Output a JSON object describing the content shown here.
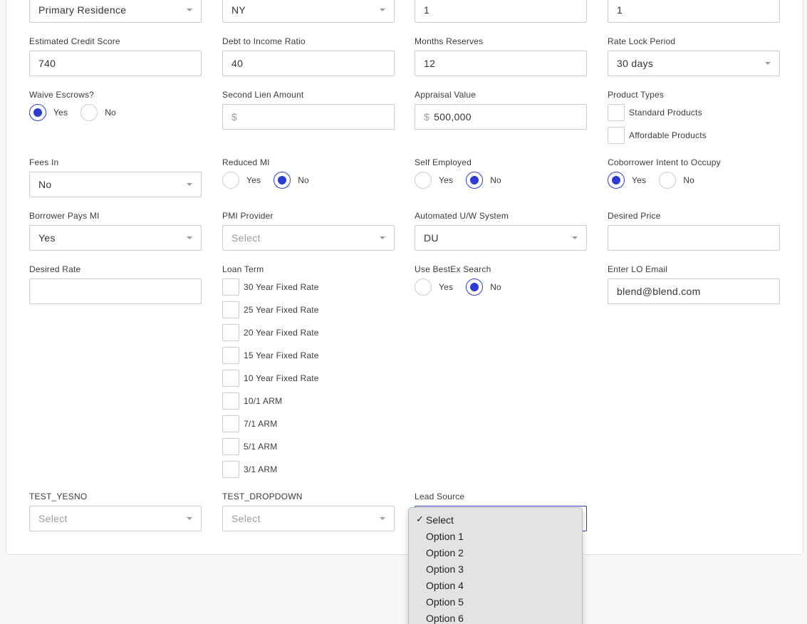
{
  "row0": {
    "occupancy": "Primary Residence",
    "state": "NY",
    "field3": "1",
    "field4": "1"
  },
  "row1": {
    "credit_score": {
      "label": "Estimated Credit Score",
      "value": "740"
    },
    "dti": {
      "label": "Debt to Income Ratio",
      "value": "40"
    },
    "reserves": {
      "label": "Months Reserves",
      "value": "12"
    },
    "rate_lock": {
      "label": "Rate Lock Period",
      "value": "30 days"
    }
  },
  "row2": {
    "waive_escrows": {
      "label": "Waive Escrows?",
      "yes": "Yes",
      "no": "No",
      "selected": "Yes"
    },
    "second_lien": {
      "label": "Second Lien Amount",
      "prefix": "$",
      "value": ""
    },
    "appraisal": {
      "label": "Appraisal Value",
      "prefix": "$",
      "value": "500,000"
    },
    "product_types": {
      "label": "Product Types",
      "options": [
        "Standard Products",
        "Affordable Products"
      ]
    }
  },
  "row3": {
    "fees_in": {
      "label": "Fees In",
      "value": "No"
    },
    "reduced_mi": {
      "label": "Reduced MI",
      "yes": "Yes",
      "no": "No",
      "selected": "No"
    },
    "self_employed": {
      "label": "Self Employed",
      "yes": "Yes",
      "no": "No",
      "selected": "No"
    },
    "coborrower": {
      "label": "Coborrower Intent to Occupy",
      "yes": "Yes",
      "no": "No",
      "selected": "Yes"
    }
  },
  "row4": {
    "borrower_pays_mi": {
      "label": "Borrower Pays MI",
      "value": "Yes"
    },
    "pmi_provider": {
      "label": "PMI Provider",
      "placeholder": "Select"
    },
    "aus": {
      "label": "Automated U/W System",
      "value": "DU"
    },
    "desired_price": {
      "label": "Desired Price",
      "value": ""
    }
  },
  "row5": {
    "desired_rate": {
      "label": "Desired Rate",
      "value": ""
    },
    "loan_term": {
      "label": "Loan Term",
      "options": [
        "30 Year Fixed Rate",
        "25 Year Fixed Rate",
        "20 Year Fixed Rate",
        "15 Year Fixed Rate",
        "10 Year Fixed Rate",
        "10/1 ARM",
        "7/1 ARM",
        "5/1 ARM",
        "3/1 ARM"
      ]
    },
    "bestex": {
      "label": "Use BestEx Search",
      "yes": "Yes",
      "no": "No",
      "selected": "No"
    },
    "lo_email": {
      "label": "Enter LO Email",
      "value": "blend@blend.com"
    }
  },
  "row6": {
    "test_yesno": {
      "label": "TEST_YESNO",
      "placeholder": "Select"
    },
    "test_dropdown": {
      "label": "TEST_DROPDOWN",
      "placeholder": "Select"
    },
    "lead_source": {
      "label": "Lead Source"
    }
  },
  "lead_source_menu": {
    "options": [
      "Select",
      "Option 1",
      "Option 2",
      "Option 3",
      "Option 4",
      "Option 5",
      "Option 6"
    ],
    "selected": "Select",
    "check_glyph": "✓"
  },
  "colors": {
    "accent": "#2c3cd0",
    "border": "#ccccd0",
    "placeholder": "#9a9ba1"
  }
}
